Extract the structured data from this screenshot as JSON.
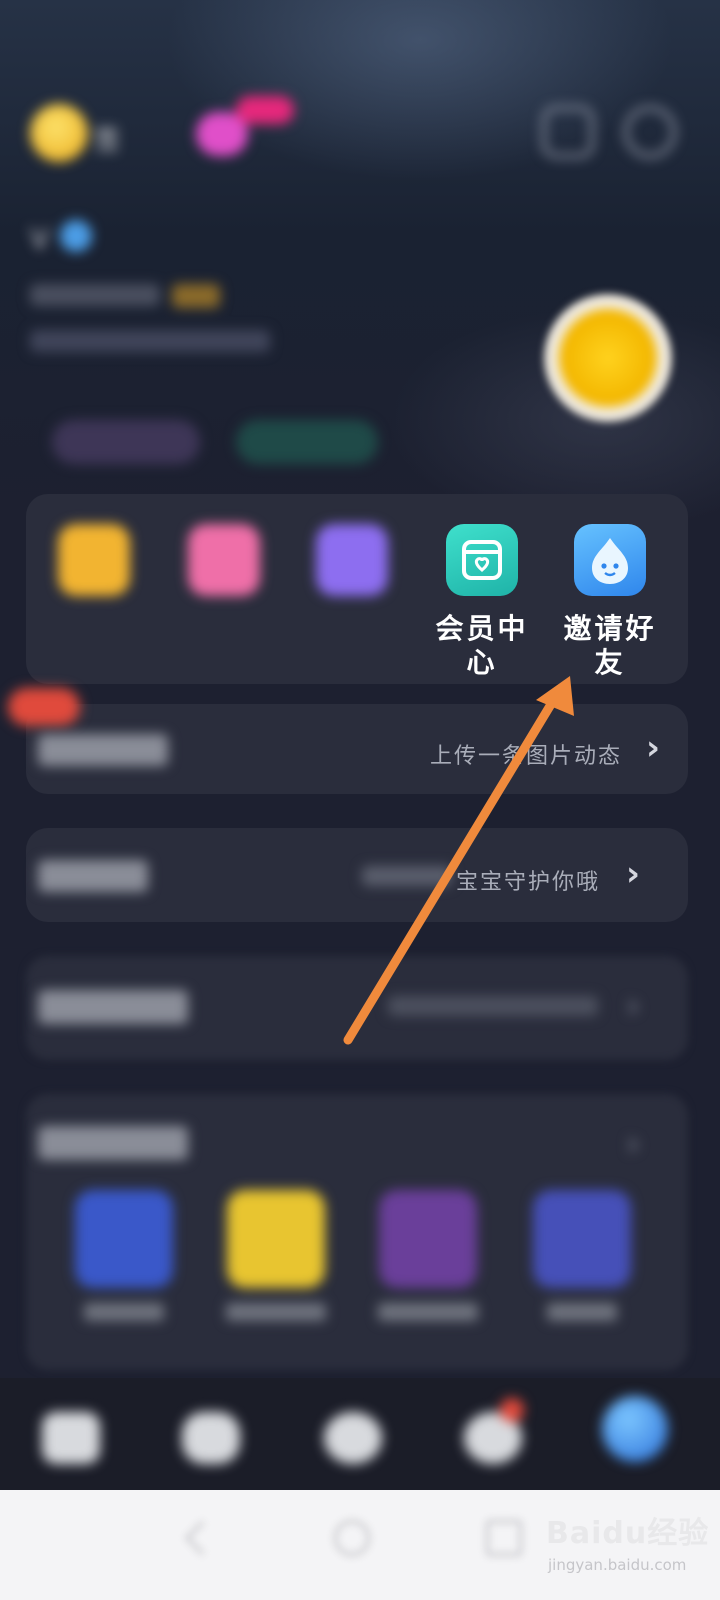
{
  "header": {
    "avatar_text": "签",
    "pink_badge": "",
    "icons": [
      "bag-icon",
      "settings-icon"
    ]
  },
  "profile": {
    "name": "V",
    "bio": ""
  },
  "features": {
    "items": [
      {
        "label": "",
        "icon": "coin-icon",
        "color": "#f2b431"
      },
      {
        "label": "",
        "icon": "wallet-icon",
        "color": "#ef6fa8"
      },
      {
        "label": "",
        "icon": "mall-icon",
        "color": "#8d6ef0"
      },
      {
        "label": "会员中心",
        "icon": "member-center-icon",
        "color": "#2cc9b9"
      },
      {
        "label": "邀请好友",
        "icon": "invite-friends-icon",
        "color": "#3f97f2"
      }
    ]
  },
  "rows": [
    {
      "title": "",
      "subtitle": "上传一条图片动态",
      "chevron": "›"
    },
    {
      "title": "",
      "subtitle": "宝宝守护你哦",
      "chevron": "›"
    },
    {
      "title": "",
      "subtitle": "",
      "chevron": "›"
    },
    {
      "title": "",
      "subtitle": "",
      "chevron": "›"
    }
  ],
  "games": [
    {
      "label": "",
      "icon": "game-1-icon",
      "color": "#3a58c9"
    },
    {
      "label": "",
      "icon": "game-2-icon",
      "color": "#e8c530"
    },
    {
      "label": "",
      "icon": "game-3-icon",
      "color": "#6a3f9a"
    },
    {
      "label": "",
      "icon": "game-4-icon",
      "color": "#4650b8"
    }
  ],
  "nav": [
    "home-icon",
    "chat-icon",
    "message-icon",
    "notification-icon",
    "profile-icon"
  ],
  "watermark": {
    "brand": "Baidu经验",
    "url": "jingyan.baidu.com"
  },
  "colors": {
    "background": "#1d2030",
    "card": "#2a2d3c",
    "arrow": "#f08a3c"
  }
}
